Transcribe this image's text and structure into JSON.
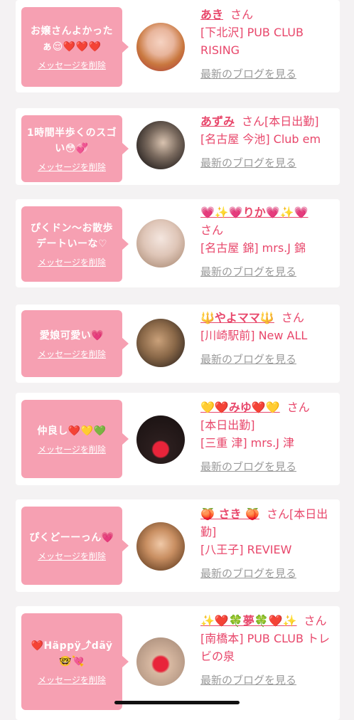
{
  "delete_label": "メッセージを削除",
  "blog_label": "最新のブログを見る",
  "colors": {
    "bubble": "#f6a0b2",
    "accent": "#e8476b",
    "muted": "#9a9a9a"
  },
  "cards": [
    {
      "message": "お嬢さんよかったぁ😌❤️❤️❤️",
      "name": "あき",
      "san": "さん",
      "shop": "[下北沢] PUB CLUB RISING"
    },
    {
      "message": "1時間半歩くのスゴい😳💞",
      "name": "あずみ",
      "san": "さん[本日出勤]",
      "shop": "[名古屋 今池] Club em"
    },
    {
      "message": "ぴくドン〜お散歩デートいーな♡",
      "name": "💗✨💗りか💗✨💗",
      "san": "さん",
      "shop": "[名古屋 錦] mrs.J 錦"
    },
    {
      "message": "愛娘可愛い💗",
      "name": "🔱やよママ🔱",
      "san": "さん",
      "shop": "[川崎駅前] New ALL"
    },
    {
      "message": "仲良し❤️💛💚",
      "name": "💛❤️みゆ❤️💛",
      "san": "さん",
      "shop": "[本日出勤]\n[三重 津] mrs.J 津"
    },
    {
      "message": "ぴくどーーっん💗",
      "name": "🍑 さき 🍑",
      "san": "さん[本日出勤]",
      "shop": "[八王子] REVIEW"
    },
    {
      "message": "❤️Häppÿ⤴︎dãÿ🤓💘",
      "name": "✨❤️🍀夢🍀❤️✨",
      "san": "さん",
      "shop": "[南橋本] PUB CLUB トレビの泉"
    }
  ]
}
